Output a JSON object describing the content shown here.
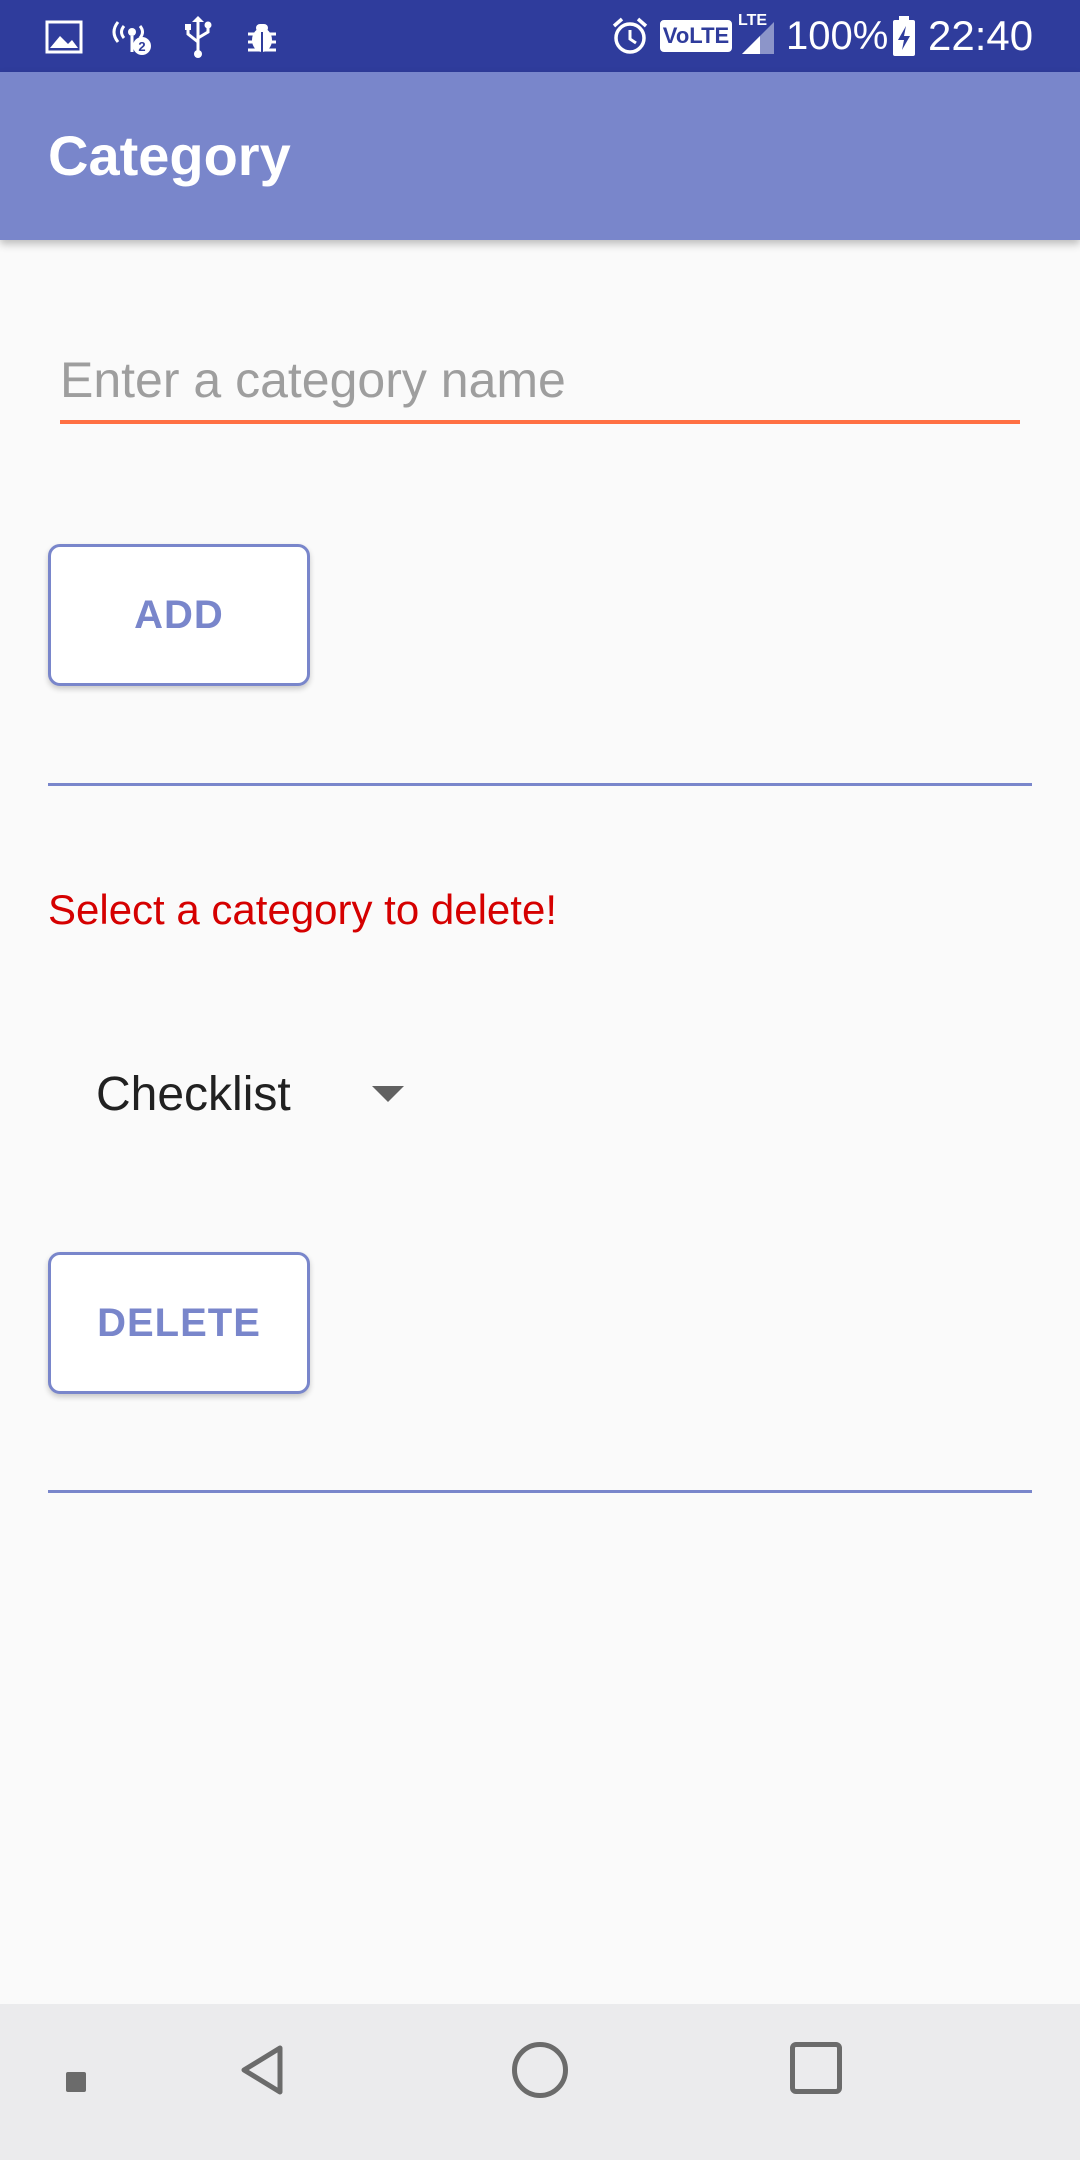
{
  "status_bar": {
    "icons_left": [
      "image-icon",
      "hotspot-icon",
      "usb-icon",
      "bug-icon"
    ],
    "volte_label": "VoLTE",
    "lte_label": "LTE",
    "battery_percent": "100%",
    "time": "22:40",
    "background_color": "#2f3c9c"
  },
  "app_bar": {
    "title": "Category",
    "color": "#7986cb"
  },
  "form": {
    "category_input": {
      "value": "",
      "placeholder": "Enter a category name"
    },
    "add_label": "ADD",
    "delete_prompt": "Select a category to delete!",
    "selected_category": "Checklist",
    "delete_label": "DELETE",
    "accent_color": "#7986cb",
    "error_color": "#d50000",
    "input_underline_color": "#ff7043"
  },
  "nav_bar": {
    "buttons": [
      "dot",
      "back",
      "home",
      "recent"
    ]
  }
}
